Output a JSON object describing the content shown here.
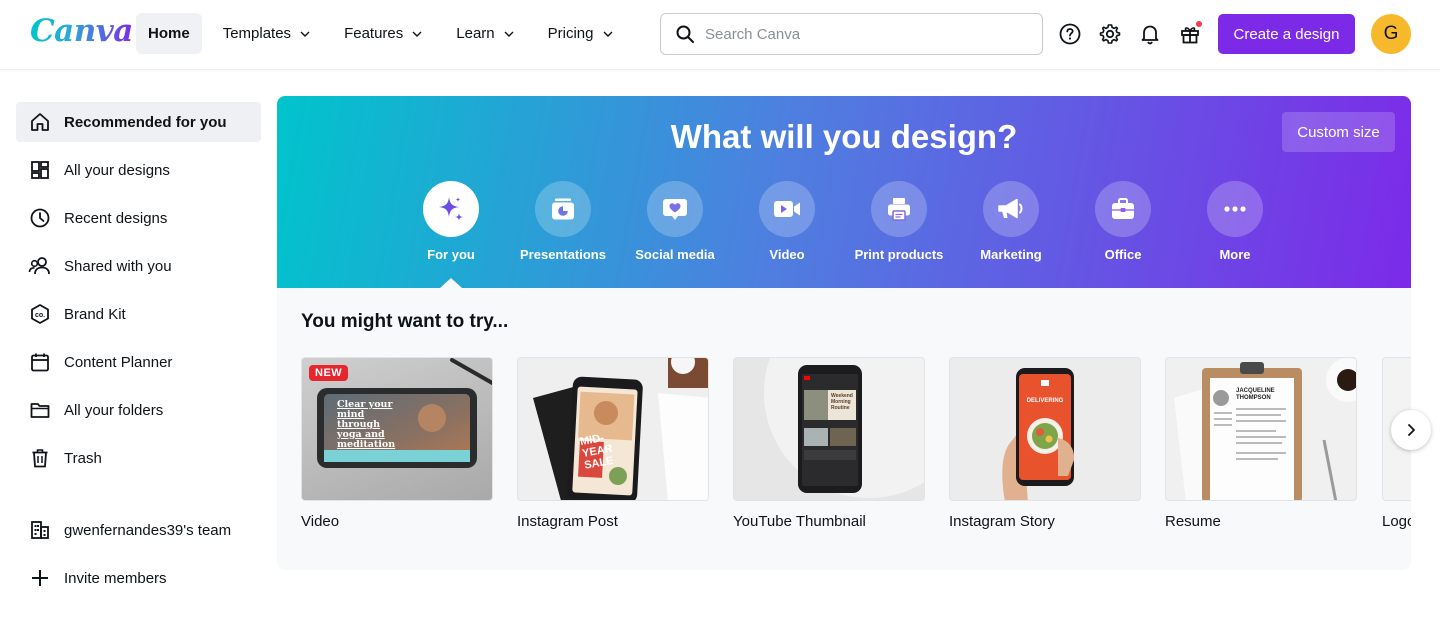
{
  "topbar": {
    "logo": "Canva",
    "nav": [
      {
        "label": "Home",
        "active": true,
        "dropdown": false
      },
      {
        "label": "Templates",
        "active": false,
        "dropdown": true
      },
      {
        "label": "Features",
        "active": false,
        "dropdown": true
      },
      {
        "label": "Learn",
        "active": false,
        "dropdown": true
      },
      {
        "label": "Pricing",
        "active": false,
        "dropdown": true
      }
    ],
    "search_placeholder": "Search Canva",
    "icons": [
      "help-icon",
      "gear-icon",
      "bell-icon",
      "gift-icon"
    ],
    "create_label": "Create a design",
    "avatar_initial": "G"
  },
  "sidebar": {
    "items": [
      {
        "label": "Recommended for you",
        "icon": "home-icon",
        "active": true
      },
      {
        "label": "All your designs",
        "icon": "grid-icon",
        "active": false
      },
      {
        "label": "Recent designs",
        "icon": "clock-icon",
        "active": false
      },
      {
        "label": "Shared with you",
        "icon": "people-icon",
        "active": false
      },
      {
        "label": "Brand Kit",
        "icon": "brand-kit-icon",
        "active": false
      },
      {
        "label": "Content Planner",
        "icon": "calendar-icon",
        "active": false
      },
      {
        "label": "All your folders",
        "icon": "folder-icon",
        "active": false
      },
      {
        "label": "Trash",
        "icon": "trash-icon",
        "active": false
      }
    ],
    "team": {
      "label": "gwenfernandes39's team",
      "icon": "team-icon"
    },
    "invite": {
      "label": "Invite members",
      "icon": "plus-icon"
    }
  },
  "hero": {
    "title": "What will you design?",
    "custom_size_label": "Custom size",
    "categories": [
      {
        "label": "For you",
        "icon": "sparkle-icon",
        "active": true
      },
      {
        "label": "Presentations",
        "icon": "presentation-icon",
        "active": false
      },
      {
        "label": "Social media",
        "icon": "heart-icon",
        "active": false
      },
      {
        "label": "Video",
        "icon": "video-icon",
        "active": false
      },
      {
        "label": "Print products",
        "icon": "printer-icon",
        "active": false
      },
      {
        "label": "Marketing",
        "icon": "megaphone-icon",
        "active": false
      },
      {
        "label": "Office",
        "icon": "briefcase-icon",
        "active": false
      },
      {
        "label": "More",
        "icon": "more-icon",
        "active": false
      }
    ]
  },
  "suggestions": {
    "title": "You might want to try...",
    "cards": [
      {
        "label": "Video",
        "badge": "NEW",
        "thumb_text": "Clear your mind through yoga and meditation"
      },
      {
        "label": "Instagram Post",
        "thumb_text": "MID-YEAR SALE"
      },
      {
        "label": "YouTube Thumbnail",
        "thumb_text": "Weekend Morning Routine"
      },
      {
        "label": "Instagram Story",
        "thumb_text": "DELIVERING"
      },
      {
        "label": "Resume",
        "thumb_text": "JACQUELINE THOMPSON"
      },
      {
        "label": "Logo"
      }
    ]
  },
  "colors": {
    "brand_purple": "#7d2ae8",
    "hero_start": "#00c4cc",
    "hero_end": "#7c2ae8",
    "avatar": "#f7b92c",
    "new_badge": "#e5262d"
  }
}
